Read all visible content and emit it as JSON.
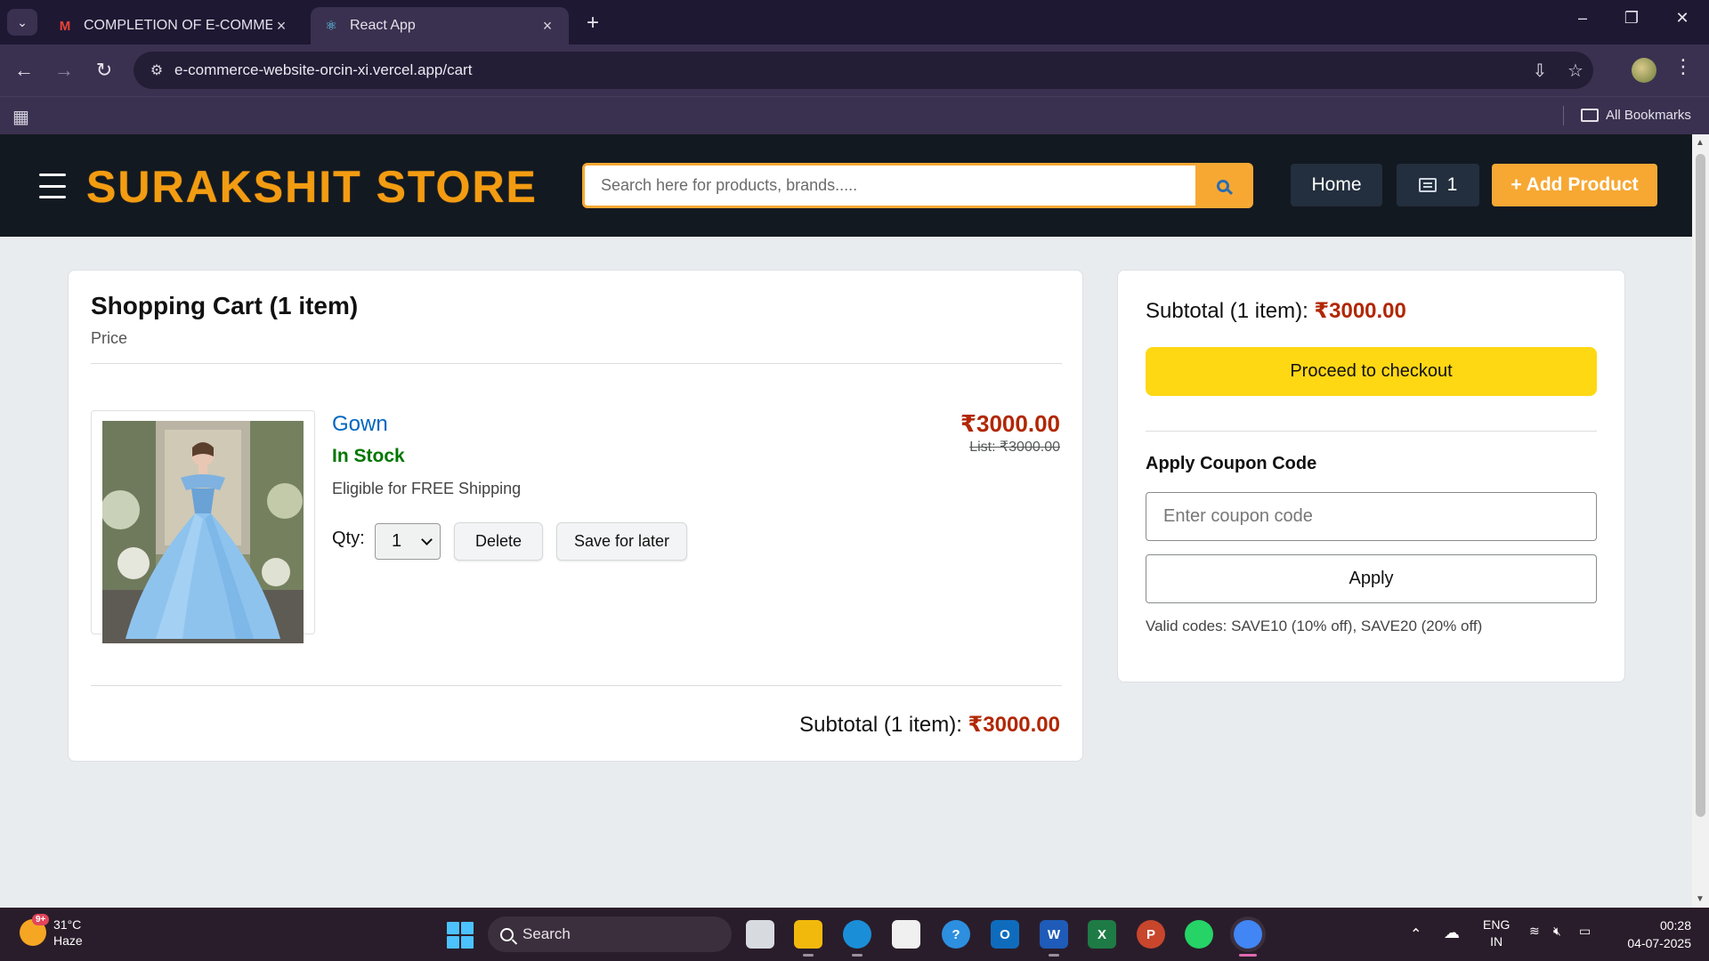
{
  "browser": {
    "tabs": [
      {
        "title": "COMPLETION OF E-COMMERCE",
        "icon": "gmail-icon"
      },
      {
        "title": "React App",
        "icon": "react-icon"
      }
    ],
    "url": "e-commerce-website-orcin-xi.vercel.app/cart",
    "bookmarks_label": "All Bookmarks"
  },
  "header": {
    "brand": "SURAKSHIT STORE",
    "search_placeholder": "Search here for products, brands.....",
    "home_label": "Home",
    "cart_count": "1",
    "add_product_label": "+ Add Product"
  },
  "cart": {
    "title": "Shopping Cart (1 item)",
    "price_heading": "Price",
    "items": [
      {
        "name": "Gown",
        "stock": "In Stock",
        "shipping": "Eligible for FREE Shipping",
        "qty_label": "Qty:",
        "qty": "1",
        "delete_label": "Delete",
        "save_label": "Save for later",
        "price": "₹3000.00",
        "list_price": "List: ₹3000.00"
      }
    ],
    "subtotal_label": "Subtotal (1 item):",
    "subtotal_amount": "₹3000.00"
  },
  "summary": {
    "subtotal_label": "Subtotal (1 item):",
    "subtotal_amount": "₹3000.00",
    "checkout_label": "Proceed to checkout",
    "coupon_title": "Apply Coupon Code",
    "coupon_placeholder": "Enter coupon code",
    "apply_label": "Apply",
    "valid_codes": "Valid codes: SAVE10 (10% off), SAVE20 (20% off)"
  },
  "taskbar": {
    "temperature": "31°C",
    "weather": "Haze",
    "weather_badge": "9+",
    "search_label": "Search",
    "language": "ENG",
    "region": "IN",
    "time": "00:28",
    "date": "04-07-2025"
  },
  "colors": {
    "brand": "#f39c12",
    "header_bg": "#131921",
    "price": "#b12704",
    "in_stock": "#007600",
    "checkout": "#ffd814",
    "link": "#0066c0"
  }
}
